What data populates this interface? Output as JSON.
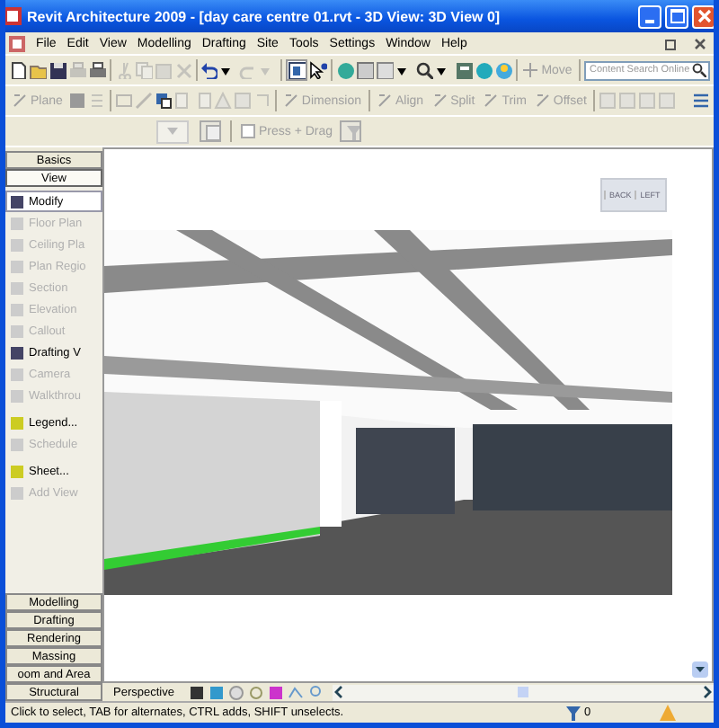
{
  "window": {
    "title": "Revit Architecture 2009 - [day care centre 01.rvt - 3D View: 3D View 0]"
  },
  "menu": [
    "File",
    "Edit",
    "View",
    "Modelling",
    "Drafting",
    "Site",
    "Tools",
    "Settings",
    "Window",
    "Help"
  ],
  "toolbar": {
    "move": {
      "label": "Move",
      "disabled": true
    },
    "edit_tools": [
      {
        "label": "Plane",
        "disabled": true
      },
      {
        "label": "Dimension",
        "disabled": true
      },
      {
        "label": "Align",
        "disabled": true
      },
      {
        "label": "Split",
        "disabled": true
      },
      {
        "label": "Trim",
        "disabled": true
      },
      {
        "label": "Offset",
        "disabled": true
      }
    ]
  },
  "search": {
    "placeholder": "Content Search Online"
  },
  "options_bar": {
    "press_drag": {
      "label": "Press + Drag",
      "checked": false,
      "disabled": true
    }
  },
  "design_bar": {
    "top_tabs": [
      {
        "label": "Basics",
        "selected": false
      },
      {
        "label": "View",
        "selected": true
      }
    ],
    "items": [
      {
        "label": "Modify",
        "disabled": false,
        "selected": true
      },
      {
        "label": "Floor Plan",
        "disabled": true,
        "selected": false
      },
      {
        "label": "Ceiling Pla",
        "disabled": true,
        "selected": false
      },
      {
        "label": "Plan Regio",
        "disabled": true,
        "selected": false
      },
      {
        "label": "Section",
        "disabled": true,
        "selected": false
      },
      {
        "label": "Elevation",
        "disabled": true,
        "selected": false
      },
      {
        "label": "Callout",
        "disabled": true,
        "selected": false
      },
      {
        "label": "Drafting V",
        "disabled": false,
        "selected": false
      },
      {
        "label": "Camera",
        "disabled": true,
        "selected": false
      },
      {
        "label": "Walkthrou",
        "disabled": true,
        "selected": false
      },
      {
        "label": "Legend...",
        "disabled": false,
        "selected": false
      },
      {
        "label": "Schedule",
        "disabled": true,
        "selected": false
      },
      {
        "label": "Sheet...",
        "disabled": false,
        "selected": false
      },
      {
        "label": "Add View",
        "disabled": true,
        "selected": false
      }
    ],
    "bottom_tabs": [
      {
        "label": "Modelling",
        "selected": false
      },
      {
        "label": "Drafting",
        "selected": false
      },
      {
        "label": "Rendering",
        "selected": false
      },
      {
        "label": "Massing",
        "selected": false
      },
      {
        "label": "oom and Area",
        "selected": false
      },
      {
        "label": "Structural",
        "selected": false
      }
    ]
  },
  "view_cube": {
    "faces": [
      "BACK",
      "LEFT"
    ]
  },
  "view_control_bar": {
    "label": "Perspective"
  },
  "status_bar": {
    "text": "Click to select, TAB for alternates, CTRL adds, SHIFT unselects.",
    "filter_count": "0"
  }
}
